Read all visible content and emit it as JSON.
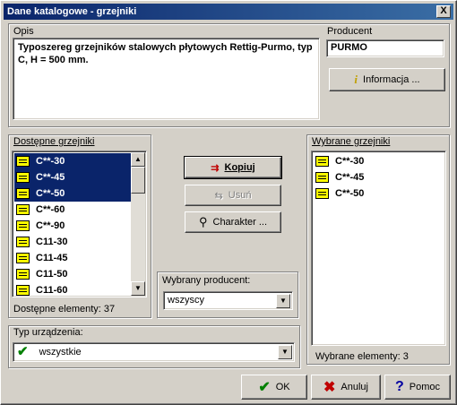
{
  "window": {
    "title": "Dane katalogowe - grzejniki",
    "close_glyph": "X"
  },
  "opis": {
    "label": "Opis",
    "text": "Typoszereg grzejników stalowych płytowych Rettig-Purmo, typ C, H = 500 mm."
  },
  "producent": {
    "label": "Producent",
    "value": "PURMO",
    "info_button": "Informacja ..."
  },
  "available": {
    "label": "Dostępne grzejniki",
    "items": [
      {
        "label": "C**-30",
        "selected": true
      },
      {
        "label": "C**-45",
        "selected": true
      },
      {
        "label": "C**-50",
        "selected": true
      },
      {
        "label": "C**-60",
        "selected": false
      },
      {
        "label": "C**-90",
        "selected": false
      },
      {
        "label": "C11-30",
        "selected": false
      },
      {
        "label": "C11-45",
        "selected": false
      },
      {
        "label": "C11-50",
        "selected": false
      },
      {
        "label": "C11-60",
        "selected": false
      }
    ],
    "count_text": "Dostępne elementy: 37"
  },
  "actions": {
    "kopiuj": "Kopiuj",
    "usun": "Usuń",
    "charakter": "Charakter ..."
  },
  "wybrany_producent": {
    "label": "Wybrany producent:",
    "value": "wszyscy"
  },
  "selected": {
    "label": "Wybrane grzejniki",
    "items": [
      "C**-30",
      "C**-45",
      "C**-50"
    ],
    "count_text": "Wybrane elementy: 3"
  },
  "typ_urzadzenia": {
    "label": "Typ urządzenia:",
    "value": "wszystkie"
  },
  "footer": {
    "ok": "OK",
    "anuluj": "Anuluj",
    "pomoc": "Pomoc"
  },
  "colors": {
    "selection": "#0a246a",
    "title_bar": "#0a246a",
    "icon_fill": "#ffff00"
  }
}
